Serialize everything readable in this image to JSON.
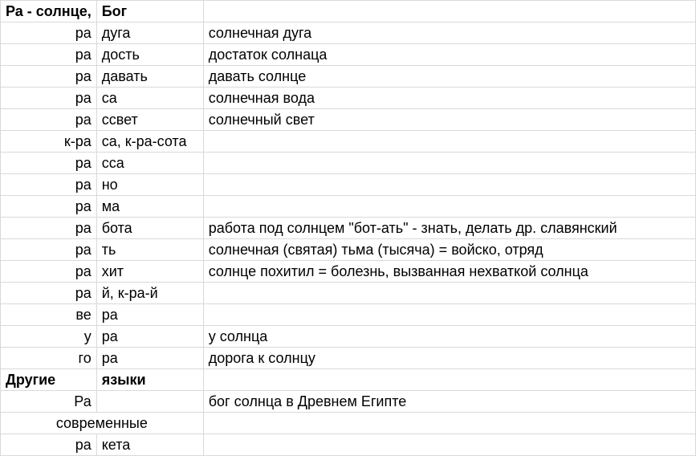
{
  "title_a": "Ра - солнце,",
  "title_b": "Бог",
  "rows": [
    {
      "a": "ра",
      "b": "дуга",
      "c": "солнечная дуга"
    },
    {
      "a": "ра",
      "b": "дость",
      "c": "достаток солнаца"
    },
    {
      "a": "ра",
      "b": "давать",
      "c": "давать солнце"
    },
    {
      "a": "ра",
      "b": "са",
      "c": "солнечная вода"
    },
    {
      "a": "ра",
      "b": "ссвет",
      "c": "солнечный свет"
    },
    {
      "a": "к-ра",
      "b": "са, к-ра-сота",
      "c": ""
    },
    {
      "a": "ра",
      "b": "сса",
      "c": ""
    },
    {
      "a": "ра",
      "b": "но",
      "c": ""
    },
    {
      "a": "ра",
      "b": "ма",
      "c": ""
    },
    {
      "a": "ра",
      "b": "бота",
      "c": "работа под солнцем \"бот-ать\" - знать, делать др. славянский"
    },
    {
      "a": "ра",
      "b": "ть",
      "c": "солнечная (святая) тьма (тысяча) = войско, отряд"
    },
    {
      "a": "ра",
      "b": "хит",
      "c": "солнце похитил = болезнь, вызванная нехваткой солнца"
    },
    {
      "a": "ра",
      "b": "й, к-ра-й",
      "c": ""
    },
    {
      "a": "ве",
      "b": "ра",
      "c": ""
    },
    {
      "a": "у",
      "b": "ра",
      "c": "у солнца"
    },
    {
      "a": "го",
      "b": "ра",
      "c": "дорога к солнцу"
    }
  ],
  "section_a": "Другие",
  "section_b": "языки",
  "rows2": [
    {
      "a": "Ра",
      "b": "",
      "c": "бог солнца в Древнем Египте"
    }
  ],
  "merged_row": "современные",
  "rows3": [
    {
      "a": "ра",
      "b": "кета",
      "c": ""
    }
  ]
}
